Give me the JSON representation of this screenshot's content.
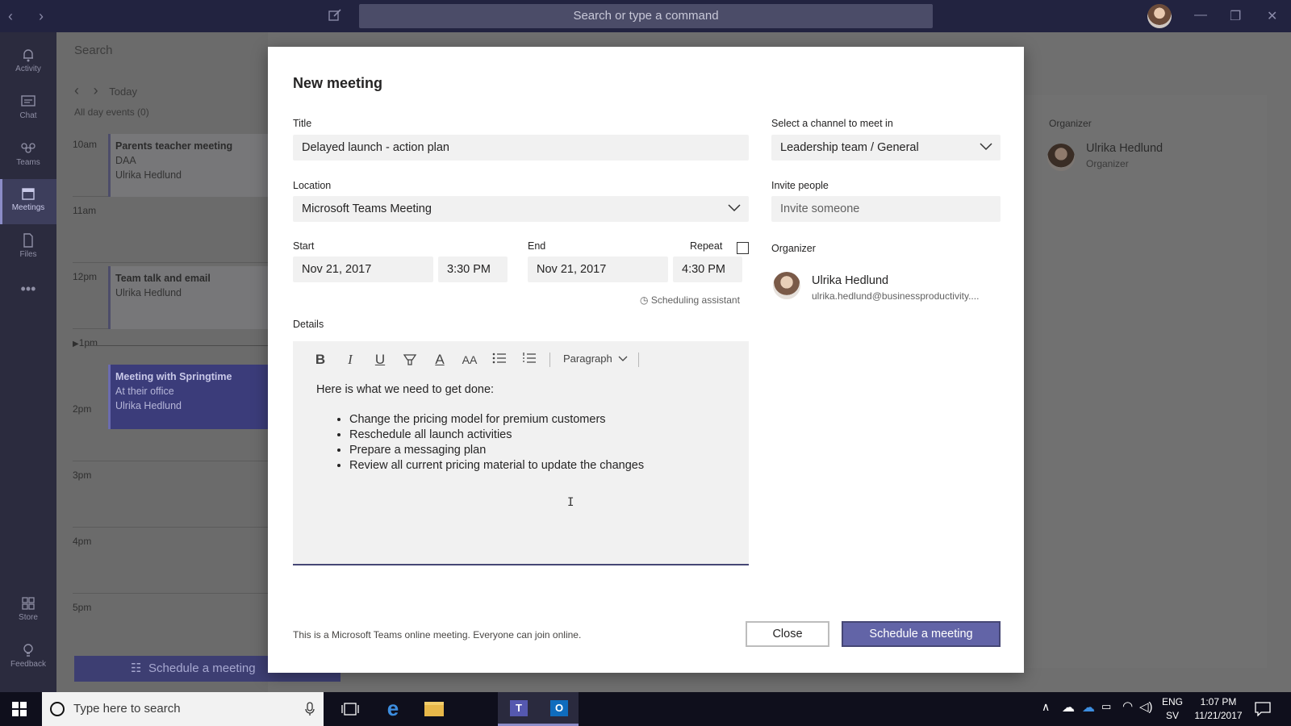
{
  "top": {
    "search_placeholder": "Search or type a command"
  },
  "rail": {
    "items": [
      {
        "label": "Activity",
        "icon": "bell-icon"
      },
      {
        "label": "Chat",
        "icon": "chat-icon"
      },
      {
        "label": "Teams",
        "icon": "teams-icon"
      },
      {
        "label": "Meetings",
        "icon": "calendar-icon",
        "active": true
      },
      {
        "label": "Files",
        "icon": "file-icon"
      },
      {
        "label": "Store",
        "icon": "store-icon"
      },
      {
        "label": "Feedback",
        "icon": "lightbulb-icon"
      }
    ]
  },
  "calendar": {
    "search": "Search",
    "today": "Today",
    "all_day": "All day events (0)",
    "hours": [
      "10am",
      "11am",
      "12pm",
      "1pm",
      "2pm",
      "3pm",
      "4pm",
      "5pm"
    ],
    "events": [
      {
        "title": "Parents teacher meeting",
        "line2": "DAA",
        "line3": "Ulrika Hedlund"
      },
      {
        "title": "Team talk and email",
        "line2": "Ulrika Hedlund"
      },
      {
        "title": "Meeting with Springtime",
        "line2": "At their office",
        "line3": "Ulrika Hedlund"
      }
    ],
    "schedule_button": "Schedule a meeting"
  },
  "right_panel": {
    "organizer_heading": "Organizer",
    "name": "Ulrika Hedlund",
    "role": "Organizer"
  },
  "dialog": {
    "heading": "New meeting",
    "title_label": "Title",
    "title_value": "Delayed launch - action plan",
    "location_label": "Location",
    "location_value": "Microsoft Teams Meeting",
    "start_label": "Start",
    "start_date": "Nov 21, 2017",
    "start_time": "3:30 PM",
    "end_label": "End",
    "end_date": "Nov 21, 2017",
    "end_time": "4:30 PM",
    "repeat_label": "Repeat",
    "scheduling_assistant": "Scheduling assistant",
    "details_label": "Details",
    "paragraph_label": "Paragraph",
    "details_intro": "Here is what we need to get done:",
    "details_items": [
      "Change the pricing model for premium customers",
      "Reschedule all launch activities",
      "Prepare a messaging plan",
      "Review all current pricing material to update the changes"
    ],
    "channel_label": "Select a channel to meet in",
    "channel_value": "Leadership team / General",
    "invite_label": "Invite people",
    "invite_placeholder": "Invite someone",
    "organizer_label": "Organizer",
    "organizer_name": "Ulrika Hedlund",
    "organizer_email": "ulrika.hedlund@businessproductivity....",
    "online_note": "This is a Microsoft Teams online meeting. Everyone can join online.",
    "close_button": "Close",
    "schedule_button": "Schedule a meeting"
  },
  "taskbar": {
    "search_placeholder": "Type here to search",
    "language": "ENG",
    "layout": "SV",
    "time": "1:07 PM",
    "date": "11/21/2017"
  },
  "colors": {
    "accent": "#6264a7",
    "topbar": "#222340",
    "rail": "#2b2b3e"
  }
}
